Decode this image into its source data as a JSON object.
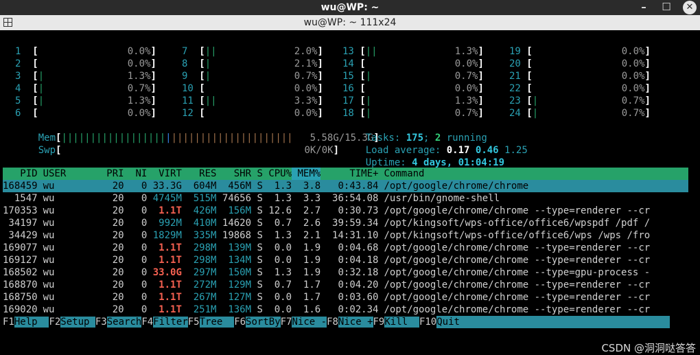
{
  "window": {
    "title": "wu@WP: ~",
    "tab_title": "wu@WP: ~ 111x24",
    "min_label": "–",
    "max_label": "☐",
    "close_label": "✕"
  },
  "cpu": [
    {
      "id": "1",
      "bar": "",
      "val": "0.0%"
    },
    {
      "id": "2",
      "bar": "",
      "val": "0.0%"
    },
    {
      "id": "3",
      "bar": "|",
      "val": "1.3%"
    },
    {
      "id": "4",
      "bar": "|",
      "val": "0.7%"
    },
    {
      "id": "5",
      "bar": "|",
      "val": "1.3%"
    },
    {
      "id": "6",
      "bar": "",
      "val": "0.0%"
    },
    {
      "id": "7",
      "bar": "||",
      "val": "2.0%"
    },
    {
      "id": "8",
      "bar": "|",
      "val": "2.1%"
    },
    {
      "id": "9",
      "bar": "|",
      "val": "0.7%"
    },
    {
      "id": "10",
      "bar": "",
      "val": "0.0%"
    },
    {
      "id": "11",
      "bar": "||",
      "val": "3.3%"
    },
    {
      "id": "12",
      "bar": "",
      "val": "0.0%"
    },
    {
      "id": "13",
      "bar": "||",
      "val": "1.3%"
    },
    {
      "id": "14",
      "bar": "",
      "val": "0.0%"
    },
    {
      "id": "15",
      "bar": "|",
      "val": "0.7%"
    },
    {
      "id": "16",
      "bar": "",
      "val": "0.0%"
    },
    {
      "id": "17",
      "bar": "|",
      "val": "1.3%"
    },
    {
      "id": "18",
      "bar": "|",
      "val": "0.7%"
    },
    {
      "id": "19",
      "bar": "",
      "val": "0.0%"
    },
    {
      "id": "20",
      "bar": "",
      "val": "0.0%"
    },
    {
      "id": "21",
      "bar": "",
      "val": "0.0%"
    },
    {
      "id": "22",
      "bar": "",
      "val": "0.0%"
    },
    {
      "id": "23",
      "bar": "|",
      "val": "0.7%"
    },
    {
      "id": "24",
      "bar": "|",
      "val": "0.7%"
    }
  ],
  "mem": {
    "label": "Mem",
    "bar_green": "||||||||||||||||||",
    "bar_blue": "|",
    "bar_orange": "|||||||||||||||||||||",
    "value": "5.58G/15.3G"
  },
  "swp": {
    "label": "Swp",
    "value": "0K/0K"
  },
  "tasks": {
    "label": "Tasks: ",
    "count": "175",
    "sep": "; ",
    "running": "2",
    "running_label": " running"
  },
  "load": {
    "label": "Load average: ",
    "v1": "0.17",
    "v2": "0.46",
    "v3": "1.25"
  },
  "uptime": {
    "label": "Uptime: ",
    "value": "4 days, 01:04:19"
  },
  "columns": {
    "pid": "PID",
    "user": "USER",
    "pri": "PRI",
    "ni": "NI",
    "virt": "VIRT",
    "res": "RES",
    "shr": "SHR",
    "s": "S",
    "cpu": "CPU%",
    "mem": "MEM%",
    "time": "TIME+",
    "cmd": "Command"
  },
  "processes": [
    {
      "pid": "168459",
      "user": "wu",
      "pri": "20",
      "ni": "0",
      "virt": "33.3G",
      "res": "604M",
      "shr": "456M",
      "s": "S",
      "cpu": "1.3",
      "mem": "3.8",
      "time": "0:43.84",
      "cmd": "/opt/google/chrome/chrome"
    },
    {
      "pid": "1547",
      "user": "wu",
      "pri": "20",
      "ni": "0",
      "virt": "4745M",
      "res": "515M",
      "shr": "74656",
      "s": "S",
      "cpu": "1.3",
      "mem": "3.3",
      "time": "36:54.08",
      "cmd": "/usr/bin/gnome-shell"
    },
    {
      "pid": "170353",
      "user": "wu",
      "pri": "20",
      "ni": "0",
      "virt": "1.1T",
      "res": "426M",
      "shr": "156M",
      "s": "S",
      "cpu": "12.6",
      "mem": "2.7",
      "time": "0:30.73",
      "cmd": "/opt/google/chrome/chrome --type=renderer --cr"
    },
    {
      "pid": "34197",
      "user": "wu",
      "pri": "20",
      "ni": "0",
      "virt": "992M",
      "res": "410M",
      "shr": "14620",
      "s": "S",
      "cpu": "0.7",
      "mem": "2.6",
      "time": "39:59.34",
      "cmd": "/opt/kingsoft/wps-office/office6/wpspdf /pdf /"
    },
    {
      "pid": "34429",
      "user": "wu",
      "pri": "20",
      "ni": "0",
      "virt": "1829M",
      "res": "335M",
      "shr": "19868",
      "s": "S",
      "cpu": "1.3",
      "mem": "2.1",
      "time": "14:31.10",
      "cmd": "/opt/kingsoft/wps-office/office6/wps /wps /fro"
    },
    {
      "pid": "169077",
      "user": "wu",
      "pri": "20",
      "ni": "0",
      "virt": "1.1T",
      "res": "298M",
      "shr": "139M",
      "s": "S",
      "cpu": "0.0",
      "mem": "1.9",
      "time": "0:04.68",
      "cmd": "/opt/google/chrome/chrome --type=renderer --cr"
    },
    {
      "pid": "169127",
      "user": "wu",
      "pri": "20",
      "ni": "0",
      "virt": "1.1T",
      "res": "298M",
      "shr": "134M",
      "s": "S",
      "cpu": "0.0",
      "mem": "1.9",
      "time": "0:04.18",
      "cmd": "/opt/google/chrome/chrome --type=renderer --cr"
    },
    {
      "pid": "168502",
      "user": "wu",
      "pri": "20",
      "ni": "0",
      "virt": "33.0G",
      "res": "297M",
      "shr": "150M",
      "s": "S",
      "cpu": "1.3",
      "mem": "1.9",
      "time": "0:32.18",
      "cmd": "/opt/google/chrome/chrome --type=gpu-process -"
    },
    {
      "pid": "168870",
      "user": "wu",
      "pri": "20",
      "ni": "0",
      "virt": "1.1T",
      "res": "272M",
      "shr": "129M",
      "s": "S",
      "cpu": "0.7",
      "mem": "1.7",
      "time": "0:04.20",
      "cmd": "/opt/google/chrome/chrome --type=renderer --cr"
    },
    {
      "pid": "168750",
      "user": "wu",
      "pri": "20",
      "ni": "0",
      "virt": "1.1T",
      "res": "267M",
      "shr": "127M",
      "s": "S",
      "cpu": "0.0",
      "mem": "1.7",
      "time": "0:03.60",
      "cmd": "/opt/google/chrome/chrome --type=renderer --cr"
    },
    {
      "pid": "169020",
      "user": "wu",
      "pri": "20",
      "ni": "0",
      "virt": "1.1T",
      "res": "251M",
      "shr": "136M",
      "s": "S",
      "cpu": "0.0",
      "mem": "1.6",
      "time": "0:02.34",
      "cmd": "/opt/google/chrome/chrome --type=renderer --cr"
    }
  ],
  "fkeys": [
    {
      "key": "F1",
      "label": "Help  "
    },
    {
      "key": "F2",
      "label": "Setup "
    },
    {
      "key": "F3",
      "label": "Search"
    },
    {
      "key": "F4",
      "label": "Filter"
    },
    {
      "key": "F5",
      "label": "Tree  "
    },
    {
      "key": "F6",
      "label": "SortBy"
    },
    {
      "key": "F7",
      "label": "Nice -"
    },
    {
      "key": "F8",
      "label": "Nice +"
    },
    {
      "key": "F9",
      "label": "Kill  "
    },
    {
      "key": "F10",
      "label": "Quit"
    }
  ],
  "watermark": "CSDN @洞洞哒答答"
}
